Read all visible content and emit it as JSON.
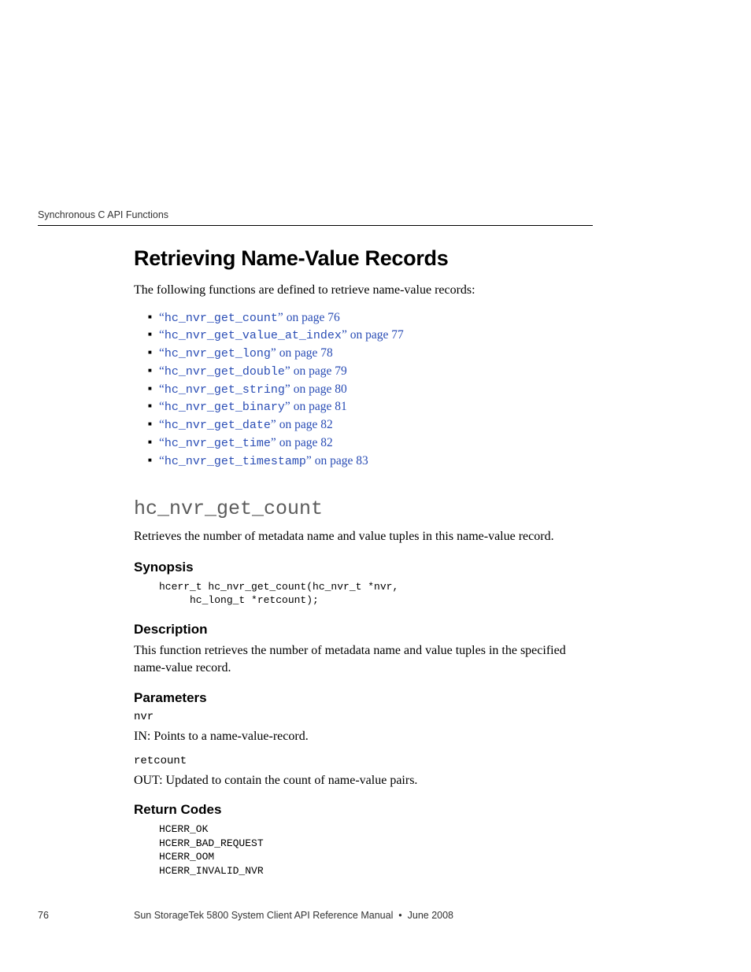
{
  "header": {
    "running": "Synchronous C API Functions"
  },
  "section": {
    "title": "Retrieving Name-Value Records",
    "intro": "The following functions are defined to retrieve name-value records:",
    "links": [
      {
        "q1": "“",
        "fn": "hc_nvr_get_count",
        "q2": "”",
        "suffix": " on page 76"
      },
      {
        "q1": "“",
        "fn": "hc_nvr_get_value_at_index",
        "q2": "”",
        "suffix": " on page 77"
      },
      {
        "q1": "“",
        "fn": "hc_nvr_get_long",
        "q2": "”",
        "suffix": " on page 78"
      },
      {
        "q1": "“",
        "fn": "hc_nvr_get_double",
        "q2": "”",
        "suffix": " on page 79"
      },
      {
        "q1": "“",
        "fn": "hc_nvr_get_string",
        "q2": "”",
        "suffix": " on page 80"
      },
      {
        "q1": "“",
        "fn": "hc_nvr_get_binary",
        "q2": "”",
        "suffix": " on page 81"
      },
      {
        "q1": "“",
        "fn": "hc_nvr_get_date",
        "q2": "”",
        "suffix": " on page 82"
      },
      {
        "q1": "“",
        "fn": "hc_nvr_get_time",
        "q2": "”",
        "suffix": " on page 82"
      },
      {
        "q1": "“",
        "fn": "hc_nvr_get_timestamp",
        "q2": "”",
        "suffix": " on page 83"
      }
    ]
  },
  "func": {
    "name": "hc_nvr_get_count",
    "summary": "Retrieves the number of metadata name and value tuples in this name-value record.",
    "synopsis_h": "Synopsis",
    "synopsis_code": "hcerr_t hc_nvr_get_count(hc_nvr_t *nvr,\n     hc_long_t *retcount);",
    "description_h": "Description",
    "description_body": "This function retrieves the number of metadata name and value tuples in the specified name-value record.",
    "parameters_h": "Parameters",
    "params": [
      {
        "name": "nvr",
        "desc": "IN: Points to a name-value-record."
      },
      {
        "name": "retcount",
        "desc": "OUT: Updated to contain the count of name-value pairs."
      }
    ],
    "return_h": "Return Codes",
    "return_codes": "HCERR_OK\nHCERR_BAD_REQUEST\nHCERR_OOM\nHCERR_INVALID_NVR"
  },
  "footer": {
    "page": "76",
    "text": "Sun StorageTek 5800 System Client API Reference Manual  •  June 2008"
  }
}
